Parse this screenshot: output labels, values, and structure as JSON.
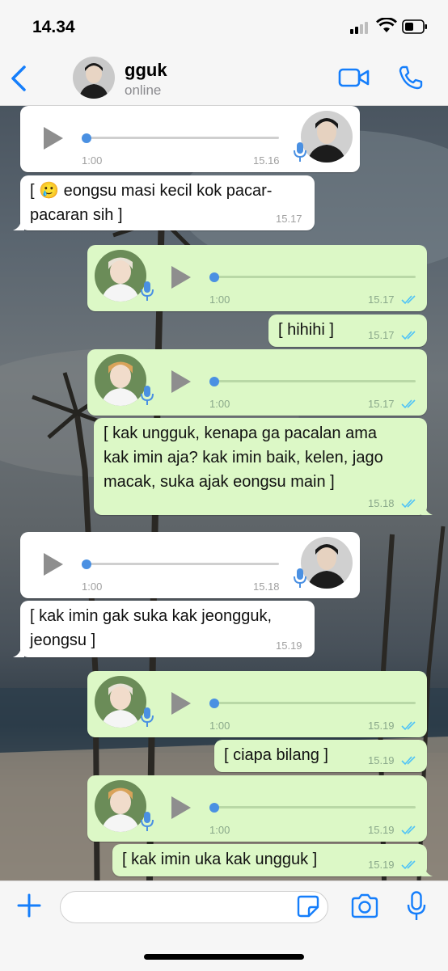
{
  "status_bar": {
    "time": "14.34"
  },
  "header": {
    "contact_name": "gguk",
    "contact_status": "online"
  },
  "messages": [
    {
      "type": "voice",
      "direction": "in",
      "duration": "1:00",
      "time": "15.16"
    },
    {
      "type": "text",
      "direction": "in",
      "lines": [
        "[ 🥲 eongsu masi kecil kok pacar-",
        "pacaran sih ]"
      ],
      "time": "15.17"
    },
    {
      "type": "voice",
      "direction": "out",
      "duration": "1:00",
      "time": "15.17"
    },
    {
      "type": "text",
      "direction": "out",
      "lines": [
        "[ hihihi ]"
      ],
      "time": "15.17"
    },
    {
      "type": "voice",
      "direction": "out",
      "duration": "1:00",
      "time": "15.17"
    },
    {
      "type": "text",
      "direction": "out",
      "lines": [
        "[ kak ungguk, kenapa ga pacalan ama",
        "kak imin aja? kak imin baik, kelen, jago",
        "macak, suka ajak eongsu main ]"
      ],
      "time": "15.18"
    },
    {
      "type": "voice",
      "direction": "in",
      "duration": "1:00",
      "time": "15.18"
    },
    {
      "type": "text",
      "direction": "in",
      "lines": [
        "[ kak imin gak suka kak jeongguk,",
        "jeongsu ]"
      ],
      "time": "15.19"
    },
    {
      "type": "voice",
      "direction": "out",
      "duration": "1:00",
      "time": "15.19"
    },
    {
      "type": "text",
      "direction": "out",
      "lines": [
        "[ ciapa bilang ]"
      ],
      "time": "15.19"
    },
    {
      "type": "voice",
      "direction": "out",
      "duration": "1:00",
      "time": "15.19"
    },
    {
      "type": "text",
      "direction": "out",
      "lines": [
        "[ kak imin uka kak ungguk ]"
      ],
      "time": "15.19"
    }
  ],
  "icons": {
    "back": "chevron-left-icon",
    "video": "video-camera-icon",
    "call": "phone-icon",
    "add": "plus-icon",
    "sticker": "sticker-icon",
    "camera": "camera-icon",
    "mic": "microphone-icon"
  },
  "colors": {
    "accent": "#157efb",
    "outgoing_bubble": "#dcf8c6",
    "incoming_bubble": "#ffffff",
    "read_ticks": "#4fc3f7"
  }
}
